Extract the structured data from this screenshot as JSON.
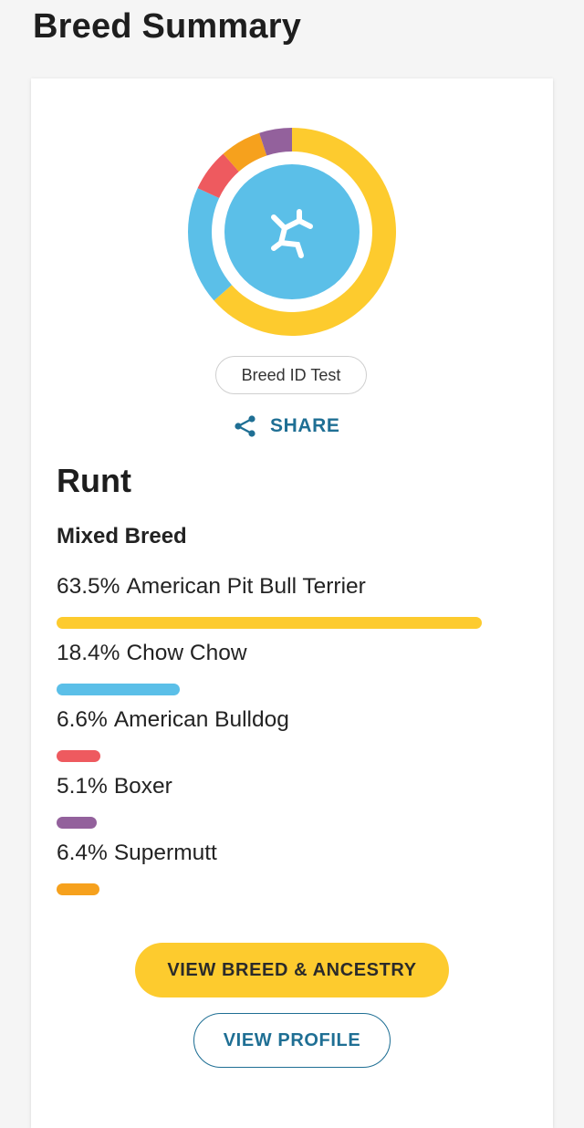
{
  "header": {
    "title": "Breed Summary"
  },
  "colors": {
    "yellow": "#fdcb2e",
    "blue": "#5bbfe8",
    "red": "#ee5a5f",
    "purple": "#93619c",
    "orange": "#f6a11d",
    "accent": "#1f6f94"
  },
  "summary": {
    "icon": "dog-bone-logo-icon",
    "test_chip": "Breed ID Test",
    "share_label": "SHARE",
    "dog_name": "Runt",
    "breed_type": "Mixed Breed",
    "breeds": [
      {
        "percent": "63.5%",
        "name": "American Pit Bull Terrier",
        "value": 63.5,
        "color": "#fdcb2e"
      },
      {
        "percent": "18.4%",
        "name": "Chow Chow",
        "value": 18.4,
        "color": "#5bbfe8"
      },
      {
        "percent": "6.6%",
        "name": "American Bulldog",
        "value": 6.6,
        "color": "#ee5a5f"
      },
      {
        "percent": "5.1%",
        "name": "Boxer",
        "value": 5.1,
        "color": "#93619c"
      },
      {
        "percent": "6.4%",
        "name": "Supermutt",
        "value": 6.4,
        "color": "#f6a11d"
      }
    ],
    "primary_button": "VIEW BREED & ANCESTRY",
    "secondary_button": "VIEW PROFILE"
  }
}
